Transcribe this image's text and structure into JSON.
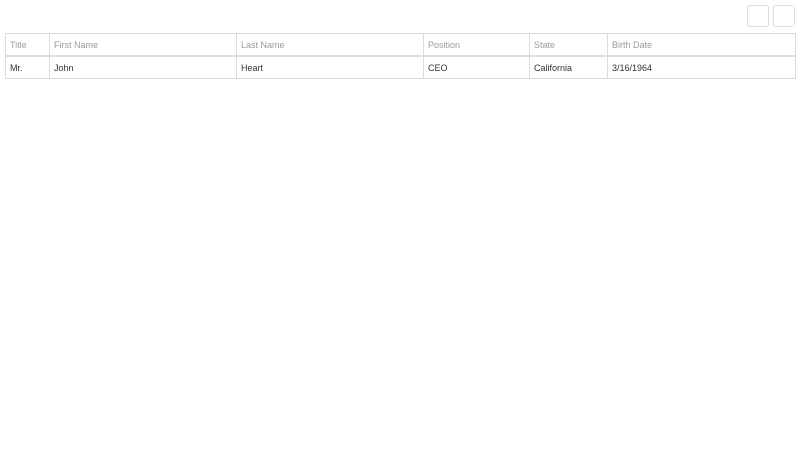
{
  "table": {
    "columns": [
      "Title",
      "First Name",
      "Last Name",
      "Position",
      "State",
      "Birth Date"
    ],
    "rows": [
      [
        "Mr.",
        "John",
        "Heart",
        "CEO",
        "California",
        "3/16/1964"
      ]
    ]
  },
  "colors": {
    "border": "#dddddd",
    "header_text": "#9a9a9a",
    "cell_text": "#333333",
    "background": "#ffffff"
  }
}
